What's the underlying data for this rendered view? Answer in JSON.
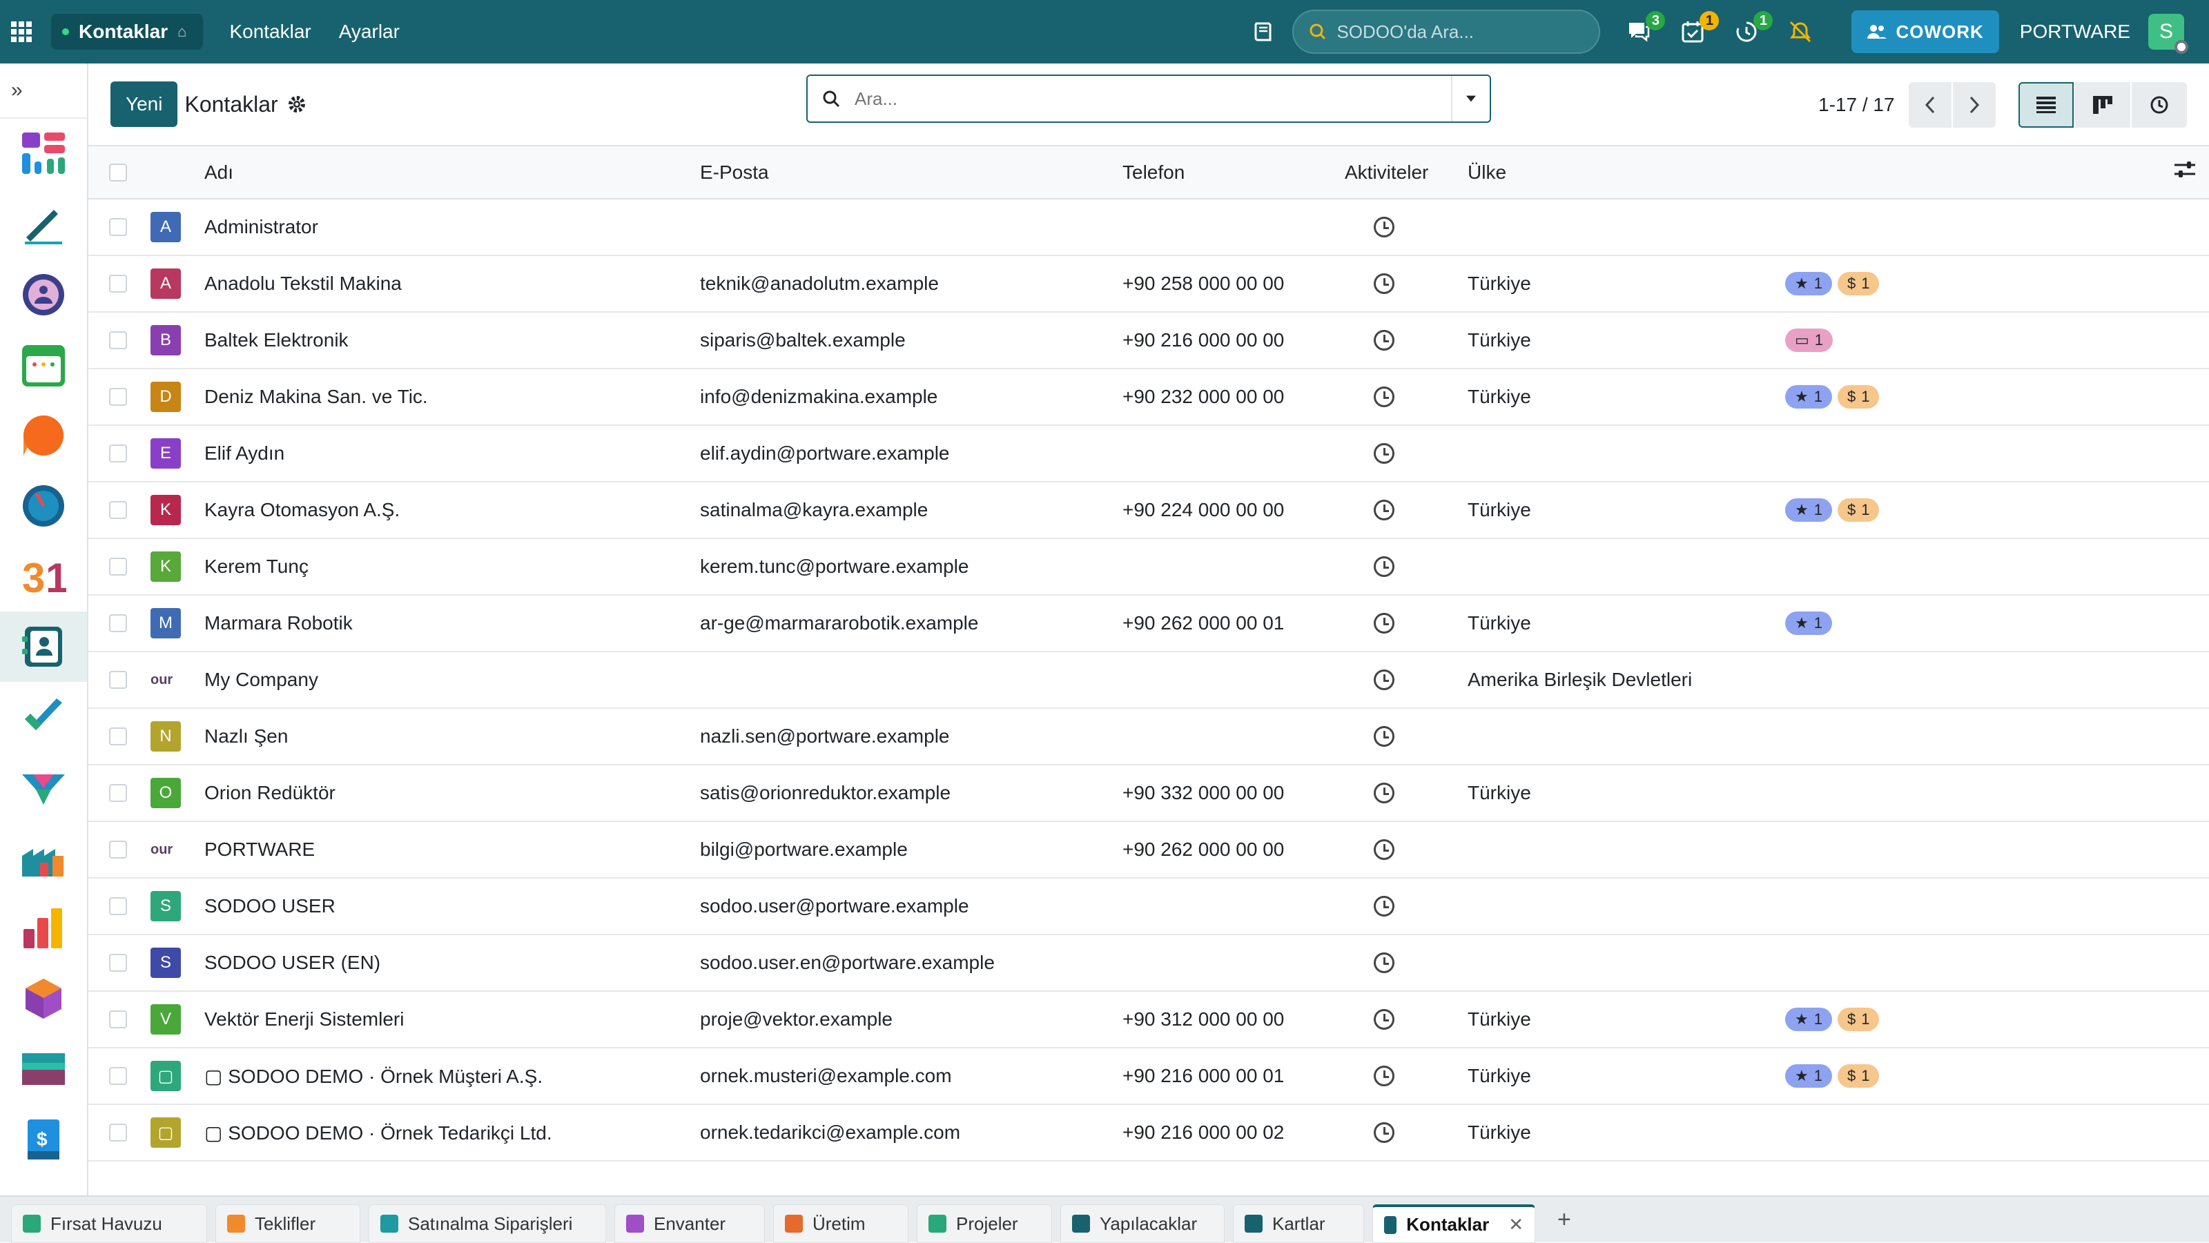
{
  "navbar": {
    "brand": "Kontaklar",
    "menus": [
      "Kontaklar",
      "Ayarlar"
    ],
    "search_placeholder": "SODOO'da Ara...",
    "badges": {
      "messages": "3",
      "activities": "1",
      "timer": "1"
    },
    "cowork": "COWORK",
    "company": "PORTWARE",
    "user_initial": "S"
  },
  "control_panel": {
    "new_button": "Yeni",
    "title": "Kontaklar",
    "search_placeholder": "Ara...",
    "pager": "1-17 / 17"
  },
  "table": {
    "headers": [
      "Adı",
      "E-Posta",
      "Telefon",
      "Aktiviteler",
      "Ülke"
    ],
    "rows": [
      {
        "initial": "A",
        "color": "#3f6bb5",
        "name": "Administrator",
        "email": "",
        "phone": "",
        "country": "",
        "tags": []
      },
      {
        "initial": "A",
        "color": "#b8385f",
        "name": "Anadolu Tekstil Makina",
        "email": "teknik@anadolutm.example",
        "phone": "+90 258 000 00 00",
        "country": "Türkiye",
        "tags": [
          {
            "type": "star",
            "count": "1"
          },
          {
            "type": "dollar",
            "count": "1"
          }
        ]
      },
      {
        "initial": "B",
        "color": "#8a3fb0",
        "name": "Baltek Elektronik",
        "email": "siparis@baltek.example",
        "phone": "+90 216 000 00 00",
        "country": "Türkiye",
        "tags": [
          {
            "type": "card",
            "count": "1"
          }
        ]
      },
      {
        "initial": "D",
        "color": "#c88414",
        "name": "Deniz Makina San. ve Tic.",
        "email": "info@denizmakina.example",
        "phone": "+90 232 000 00 00",
        "country": "Türkiye",
        "tags": [
          {
            "type": "star",
            "count": "1"
          },
          {
            "type": "dollar",
            "count": "1"
          }
        ]
      },
      {
        "initial": "E",
        "color": "#8a3fc8",
        "name": "Elif Aydın",
        "email": "elif.aydin@portware.example",
        "phone": "",
        "country": "",
        "tags": []
      },
      {
        "initial": "K",
        "color": "#b8284e",
        "name": "Kayra Otomasyon A.Ş.",
        "email": "satinalma@kayra.example",
        "phone": "+90 224 000 00 00",
        "country": "Türkiye",
        "tags": [
          {
            "type": "star",
            "count": "1"
          },
          {
            "type": "dollar",
            "count": "1"
          }
        ]
      },
      {
        "initial": "K",
        "color": "#58a83a",
        "name": "Kerem Tunç",
        "email": "kerem.tunc@portware.example",
        "phone": "",
        "country": "",
        "tags": []
      },
      {
        "initial": "M",
        "color": "#3f6bb5",
        "name": "Marmara Robotik",
        "email": "ar-ge@marmararobotik.example",
        "phone": "+90 262 000 00 01",
        "country": "Türkiye",
        "tags": [
          {
            "type": "star",
            "count": "1"
          }
        ]
      },
      {
        "initial": "our",
        "color": "logo",
        "name": "My Company",
        "email": "",
        "phone": "",
        "country": "Amerika Birleşik Devletleri",
        "tags": []
      },
      {
        "initial": "N",
        "color": "#b3a42e",
        "name": "Nazlı Şen",
        "email": "nazli.sen@portware.example",
        "phone": "",
        "country": "",
        "tags": []
      },
      {
        "initial": "O",
        "color": "#4aa83a",
        "name": "Orion Redüktör",
        "email": "satis@orionreduktor.example",
        "phone": "+90 332 000 00 00",
        "country": "Türkiye",
        "tags": []
      },
      {
        "initial": "our",
        "color": "logo",
        "name": "PORTWARE",
        "email": "bilgi@portware.example",
        "phone": "+90 262 000 00 00",
        "country": "",
        "tags": []
      },
      {
        "initial": "S",
        "color": "#2ea87a",
        "name": "SODOO USER",
        "email": "sodoo.user@portware.example",
        "phone": "",
        "country": "",
        "tags": []
      },
      {
        "initial": "S",
        "color": "#3f4aa8",
        "name": "SODOO USER (EN)",
        "email": "sodoo.user.en@portware.example",
        "phone": "",
        "country": "",
        "tags": []
      },
      {
        "initial": "V",
        "color": "#4aa83a",
        "name": "Vektör Enerji Sistemleri",
        "email": "proje@vektor.example",
        "phone": "+90 312 000 00 00",
        "country": "Türkiye",
        "tags": [
          {
            "type": "star",
            "count": "1"
          },
          {
            "type": "dollar",
            "count": "1"
          }
        ]
      },
      {
        "initial": "▢",
        "color": "#2ea87a",
        "name": "▢ SODOO DEMO · Örnek Müşteri A.Ş.",
        "email": "ornek.musteri@example.com",
        "phone": "+90 216 000 00 01",
        "country": "Türkiye",
        "tags": [
          {
            "type": "star",
            "count": "1"
          },
          {
            "type": "dollar",
            "count": "1"
          }
        ]
      },
      {
        "initial": "▢",
        "color": "#b3a42e",
        "name": "▢ SODOO DEMO · Örnek Tedarikçi Ltd.",
        "email": "ornek.tedarikci@example.com",
        "phone": "+90 216 000 00 02",
        "country": "Türkiye",
        "tags": []
      }
    ]
  },
  "bottom_tabs": [
    {
      "label": "Fırsat Havuzu",
      "color": "#2aa87a"
    },
    {
      "label": "Teklifler",
      "color": "#f08a2c"
    },
    {
      "label": "Satınalma Siparişleri",
      "color": "#1f9aa0"
    },
    {
      "label": "Envanter",
      "color": "#a04dc8"
    },
    {
      "label": "Üretim",
      "color": "#e66a2c"
    },
    {
      "label": "Projeler",
      "color": "#2aa87a"
    },
    {
      "label": "Yapılacaklar",
      "color": "#17626e"
    },
    {
      "label": "Kartlar",
      "color": "#17626e"
    },
    {
      "label": "Kontaklar",
      "color": "#17626e",
      "active": true
    }
  ]
}
